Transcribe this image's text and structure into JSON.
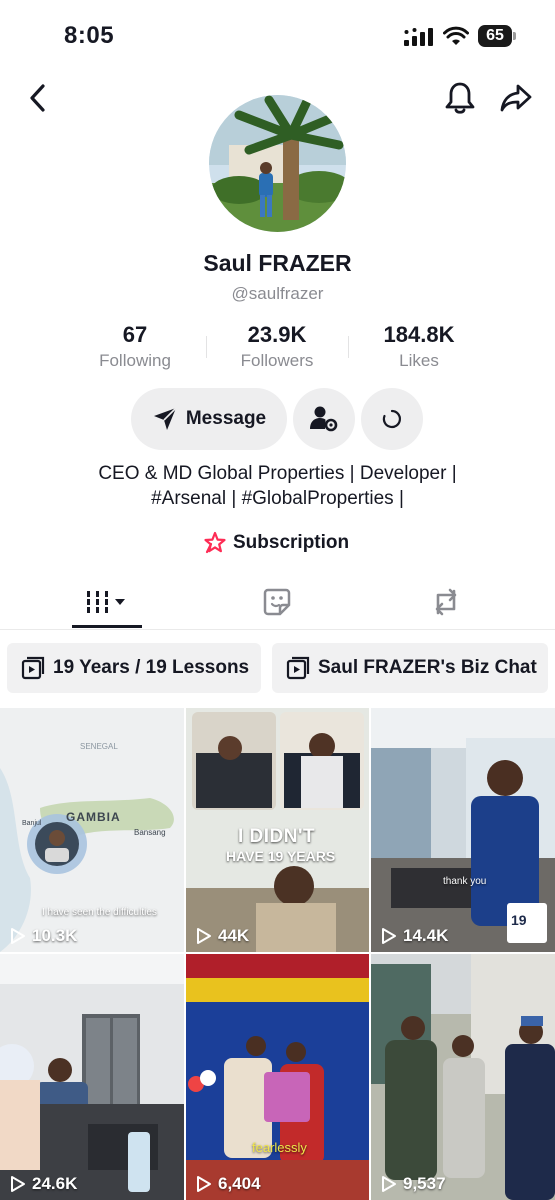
{
  "status": {
    "time": "8:05",
    "battery": "65"
  },
  "profile": {
    "name": "Saul FRAZER",
    "handle": "@saulfrazer",
    "bio_line1": "CEO & MD Global Properties | Developer |",
    "bio_line2": "#Arsenal | #GlobalProperties |",
    "subscription_label": "Subscription"
  },
  "stats": [
    {
      "value": "67",
      "label": "Following"
    },
    {
      "value": "23.9K",
      "label": "Followers"
    },
    {
      "value": "184.8K",
      "label": "Likes"
    }
  ],
  "actions": {
    "message_label": "Message"
  },
  "tabs": [
    {
      "name": "videos",
      "icon": "grid-icon",
      "active": true
    },
    {
      "name": "liked",
      "icon": "sticker-icon",
      "active": false
    },
    {
      "name": "reposts",
      "icon": "repost-icon",
      "active": false
    }
  ],
  "playlists": [
    {
      "label": "19 Years / 19 Lessons"
    },
    {
      "label": "Saul FRAZER's Biz Chat"
    }
  ],
  "videos": [
    {
      "views": "10.3K",
      "caption": "I have seen the difficulties",
      "map_label": "GAMBIA",
      "map_sub1": "SENEGAL",
      "map_sub2": "Bansang",
      "map_sub3": "Banjul"
    },
    {
      "views": "44K",
      "overlay_line1": "I DIDN'T",
      "overlay_line2": "HAVE 19 YEARS"
    },
    {
      "views": "14.4K",
      "caption": "thank you",
      "badge": "19"
    },
    {
      "views": "24.6K"
    },
    {
      "views": "6,404",
      "caption": "fearlessly"
    },
    {
      "views": "9,537"
    }
  ],
  "colors": {
    "accent": "#fe2c55",
    "text": "#161823",
    "muted": "#8a8b91",
    "button_bg": "#eeeeef"
  }
}
